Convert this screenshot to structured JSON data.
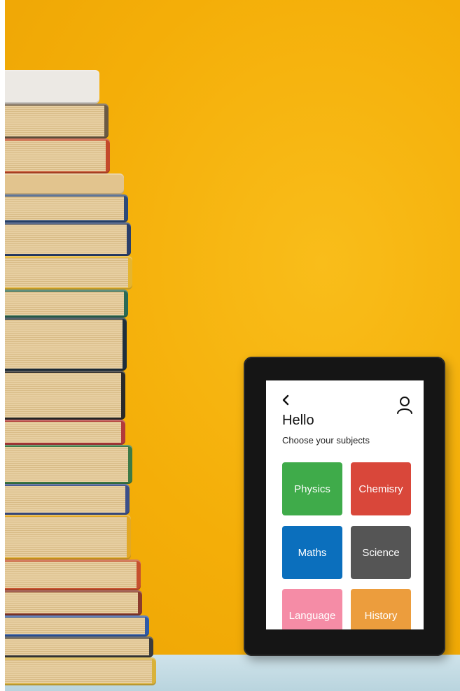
{
  "screen": {
    "greeting": "Hello",
    "subtitle": "Choose your subjects",
    "subjects": [
      {
        "label": "Physics",
        "color": "#3fab4a"
      },
      {
        "label": "Chemisry",
        "color": "#d9473a"
      },
      {
        "label": "Maths",
        "color": "#0b6fbd"
      },
      {
        "label": "Science",
        "color": "#555555"
      },
      {
        "label": "Language",
        "color": "#f58ca6"
      },
      {
        "label": "History",
        "color": "#ec9d3d"
      }
    ]
  },
  "icons": {
    "back": "chevron-left-icon",
    "profile": "user-icon"
  },
  "colors": {
    "wall": "#f6b10a",
    "tablet_frame": "#151515",
    "shelf": "#c4dbe3"
  }
}
